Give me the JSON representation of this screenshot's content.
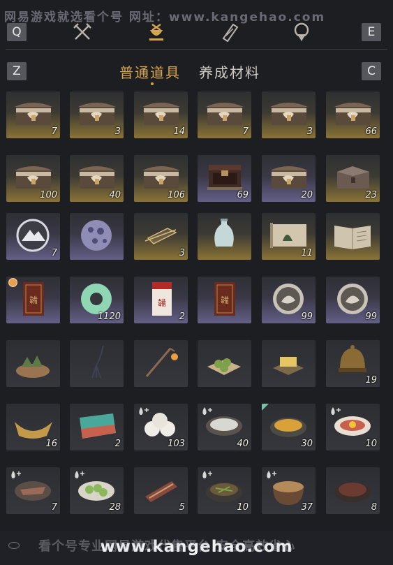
{
  "watermark": {
    "top": "网易游戏就选看个号  网址：www.kangehao.com",
    "bottom": "www.kangehao.com",
    "bottom_sub": "看个号专业网易游戏代售平台 安全高效省心"
  },
  "keys": {
    "left_top": "Q",
    "right_top": "E",
    "left_bottom": "Z",
    "right_bottom": "C"
  },
  "nav_icons": [
    "crossed-swords-icon",
    "pouch-icon",
    "scroll-icon",
    "badge-icon"
  ],
  "tabs": [
    {
      "label": "普通道具",
      "active": true
    },
    {
      "label": "养成材料",
      "active": false
    }
  ],
  "items": [
    {
      "icon": "treasure-chest-icon",
      "count": "7",
      "rarity": "gold",
      "badge": ""
    },
    {
      "icon": "treasure-chest-icon",
      "count": "3",
      "rarity": "gold",
      "badge": ""
    },
    {
      "icon": "treasure-chest-icon",
      "count": "14",
      "rarity": "gold",
      "badge": ""
    },
    {
      "icon": "treasure-chest-icon",
      "count": "7",
      "rarity": "gold",
      "badge": ""
    },
    {
      "icon": "treasure-chest-icon",
      "count": "3",
      "rarity": "gold",
      "badge": ""
    },
    {
      "icon": "treasure-chest-icon",
      "count": "66",
      "rarity": "gold",
      "badge": ""
    },
    {
      "icon": "treasure-chest-icon",
      "count": "100",
      "rarity": "gold",
      "badge": ""
    },
    {
      "icon": "treasure-chest-icon",
      "count": "40",
      "rarity": "gold",
      "badge": ""
    },
    {
      "icon": "treasure-chest-icon",
      "count": "106",
      "rarity": "gold",
      "badge": ""
    },
    {
      "icon": "dark-chest-icon",
      "count": "69",
      "rarity": "purple",
      "badge": ""
    },
    {
      "icon": "treasure-chest-icon",
      "count": "20",
      "rarity": "purple",
      "badge": ""
    },
    {
      "icon": "iron-chest-icon",
      "count": "23",
      "rarity": "gold",
      "badge": ""
    },
    {
      "icon": "mountain-emblem-icon",
      "count": "7",
      "rarity": "purple",
      "badge": ""
    },
    {
      "icon": "crystal-orb-icon",
      "count": "",
      "rarity": "purple",
      "badge": ""
    },
    {
      "icon": "golden-boat-sketch-icon",
      "count": "3",
      "rarity": "gold",
      "badge": ""
    },
    {
      "icon": "porcelain-vase-icon",
      "count": "",
      "rarity": "gold",
      "badge": ""
    },
    {
      "icon": "ancient-scroll-icon",
      "count": "11",
      "rarity": "gold",
      "badge": ""
    },
    {
      "icon": "open-book-icon",
      "count": "",
      "rarity": "gold",
      "badge": ""
    },
    {
      "icon": "red-envelope-card-icon",
      "count": "",
      "rarity": "purple",
      "badge": "clock"
    },
    {
      "icon": "jade-ring-icon",
      "count": "1120",
      "rarity": "purple",
      "badge": ""
    },
    {
      "icon": "red-envelope-white-icon",
      "count": "2",
      "rarity": "purple",
      "badge": ""
    },
    {
      "icon": "red-envelope-card-icon",
      "count": "",
      "rarity": "purple",
      "badge": ""
    },
    {
      "icon": "silver-coin-icon",
      "count": "99",
      "rarity": "purple",
      "badge": ""
    },
    {
      "icon": "silver-coin-icon",
      "count": "99",
      "rarity": "purple",
      "badge": ""
    },
    {
      "icon": "zongzi-basket-icon",
      "count": "",
      "rarity": "plain",
      "badge": ""
    },
    {
      "icon": "tassel-ornament-icon",
      "count": "",
      "rarity": "plain",
      "badge": ""
    },
    {
      "icon": "lantern-pole-icon",
      "count": "",
      "rarity": "plain",
      "badge": ""
    },
    {
      "icon": "green-dumplings-icon",
      "count": "",
      "rarity": "plain",
      "badge": ""
    },
    {
      "icon": "golden-cake-icon",
      "count": "",
      "rarity": "plain",
      "badge": ""
    },
    {
      "icon": "bronze-helmet-icon",
      "count": "19",
      "rarity": "plain",
      "badge": ""
    },
    {
      "icon": "golden-ingot-boat-icon",
      "count": "16",
      "rarity": "plain",
      "badge": ""
    },
    {
      "icon": "rainbow-stone-icon",
      "count": "2",
      "rarity": "plain",
      "badge": ""
    },
    {
      "icon": "steamed-buns-icon",
      "count": "103",
      "rarity": "plain",
      "badge": "drop"
    },
    {
      "icon": "rice-porridge-bowl-icon",
      "count": "40",
      "rarity": "plain",
      "badge": "drop"
    },
    {
      "icon": "egg-soup-bowl-icon",
      "count": "30",
      "rarity": "plain",
      "badge": "corner"
    },
    {
      "icon": "egg-plate-icon",
      "count": "10",
      "rarity": "plain",
      "badge": "drop"
    },
    {
      "icon": "meat-plate-icon",
      "count": "7",
      "rarity": "plain",
      "badge": "drop"
    },
    {
      "icon": "cucumber-plate-icon",
      "count": "28",
      "rarity": "plain",
      "badge": "drop"
    },
    {
      "icon": "grilled-meat-icon",
      "count": "5",
      "rarity": "plain",
      "badge": ""
    },
    {
      "icon": "stir-fry-bowl-icon",
      "count": "10",
      "rarity": "plain",
      "badge": "drop"
    },
    {
      "icon": "clay-pot-stew-icon",
      "count": "37",
      "rarity": "plain",
      "badge": "drop"
    },
    {
      "icon": "braised-meat-bowl-icon",
      "count": "8",
      "rarity": "plain",
      "badge": ""
    }
  ]
}
